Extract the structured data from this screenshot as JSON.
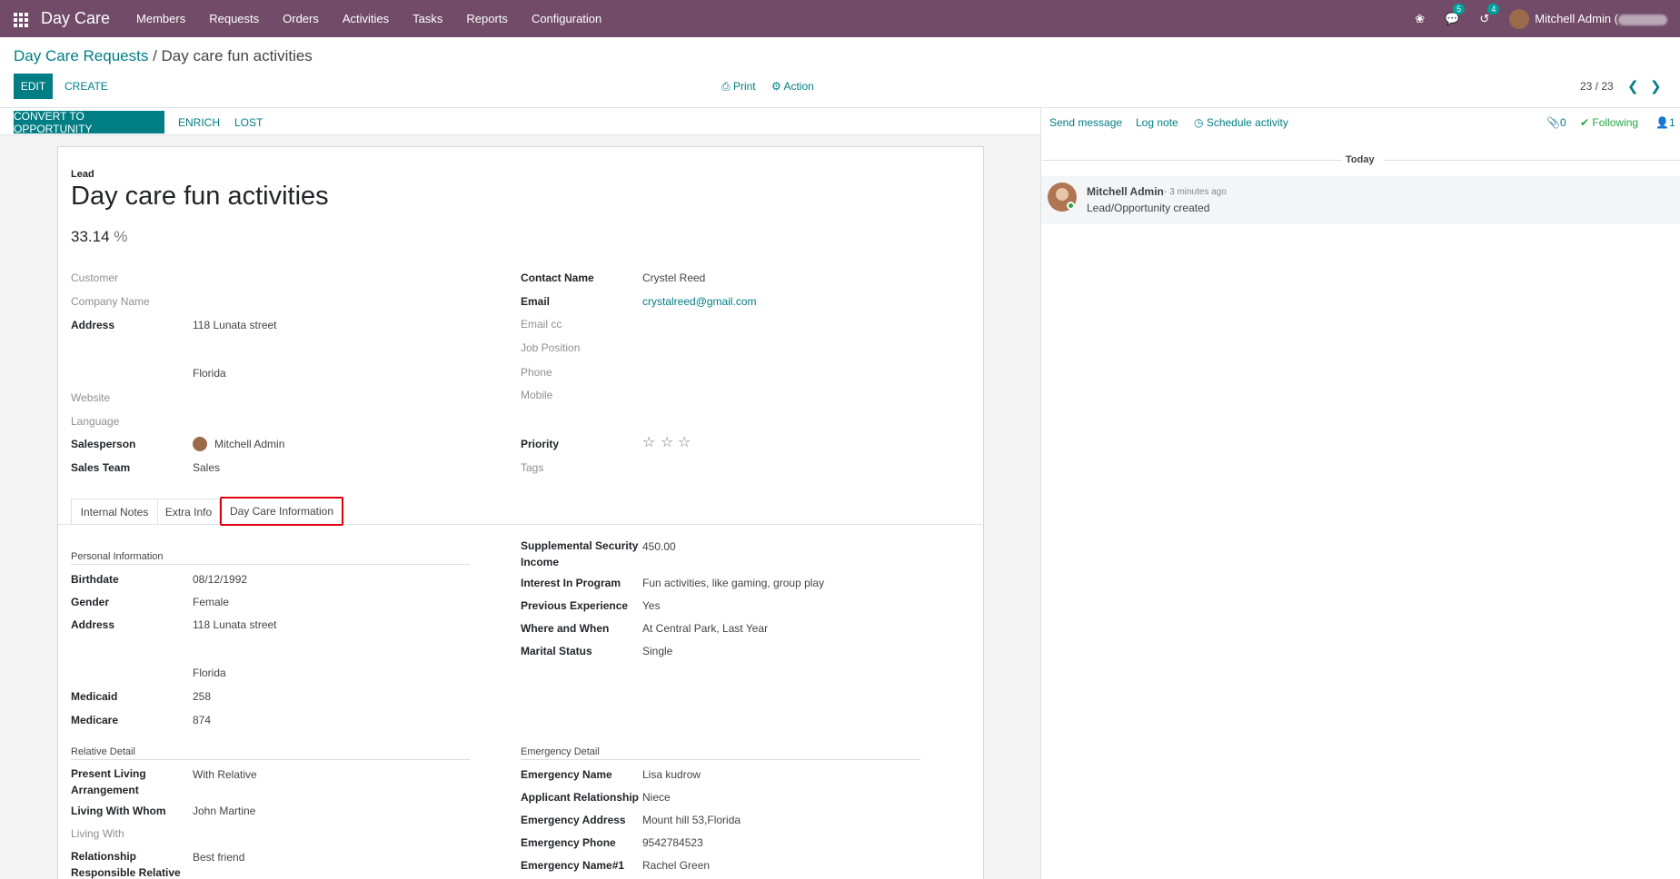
{
  "navbar": {
    "brand": "Day Care",
    "menu": [
      "Members",
      "Requests",
      "Orders",
      "Activities",
      "Tasks",
      "Reports",
      "Configuration"
    ],
    "messages_count": "5",
    "activities_count": "4",
    "user": "Mitchell Admin ("
  },
  "breadcrumb": {
    "parent": "Day Care Requests",
    "separator": " / ",
    "current": "Day care fun activities"
  },
  "controls": {
    "edit": "EDIT",
    "create": "CREATE",
    "print": "Print",
    "action": "Action",
    "pager": "23 / 23"
  },
  "statusbar": {
    "convert": "CONVERT TO OPPORTUNITY",
    "enrich": "ENRICH",
    "lost": "LOST"
  },
  "header": {
    "type_label": "Lead",
    "title": "Day care fun activities",
    "probability": "33.14",
    "percent": "%"
  },
  "left_fields": {
    "customer": "Customer",
    "company_name": "Company Name",
    "address": "Address",
    "address_street": "118 Lunata street",
    "address_state": "Florida",
    "website": "Website",
    "language": "Language",
    "salesperson": "Salesperson",
    "salesperson_value": "Mitchell Admin",
    "sales_team": "Sales Team",
    "sales_team_value": "Sales"
  },
  "right_fields": {
    "contact_name": "Contact Name",
    "contact_name_value": "Crystel Reed",
    "email": "Email",
    "email_value": "crystalreed@gmail.com",
    "email_cc": "Email cc",
    "job_position": "Job Position",
    "phone": "Phone",
    "mobile": "Mobile",
    "priority": "Priority",
    "tags": "Tags"
  },
  "tabs": [
    "Internal Notes",
    "Extra Info",
    "Day Care Information"
  ],
  "personal": {
    "title": "Personal Information",
    "birthdate": "Birthdate",
    "birthdate_value": "08/12/1992",
    "gender": "Gender",
    "gender_value": "Female",
    "address": "Address",
    "address_street": "118 Lunata street",
    "address_state": "Florida",
    "medicaid": "Medicaid",
    "medicaid_value": "258",
    "medicare": "Medicare",
    "medicare_value": "874"
  },
  "program": {
    "ssi": "Supplemental Security Income",
    "ssi_value": "450.00",
    "interest": "Interest In Program",
    "interest_value": "Fun activities, like gaming, group play",
    "experience": "Previous Experience",
    "experience_value": "Yes",
    "where_when": "Where and When",
    "where_when_value": "At Central Park, Last Year",
    "marital": "Marital Status",
    "marital_value": "Single"
  },
  "relative": {
    "title": "Relative Detail",
    "living": "Present Living Arrangement",
    "living_value": "With Relative",
    "whom": "Living With Whom",
    "whom_value": "John Martine",
    "living_with": "Living With",
    "relationship": "Relationship Responsible Relative",
    "relationship_value": "Best friend"
  },
  "emergency": {
    "title": "Emergency Detail",
    "name": "Emergency Name",
    "name_value": "Lisa kudrow",
    "relationship": "Applicant Relationship",
    "relationship_value": "Niece",
    "address": "Emergency Address",
    "address_value": "Mount hill 53,Florida",
    "phone": "Emergency Phone",
    "phone_value": "9542784523",
    "name1": "Emergency Name#1",
    "name1_value": "Rachel Green"
  },
  "chatter": {
    "send_message": "Send message",
    "log_note": "Log note",
    "schedule": "Schedule activity",
    "attachments": "0",
    "following": "Following",
    "followers": "1",
    "date_sep": "Today",
    "author": "Mitchell Admin",
    "time": "- 3 minutes ago",
    "body": "Lead/Opportunity created"
  }
}
